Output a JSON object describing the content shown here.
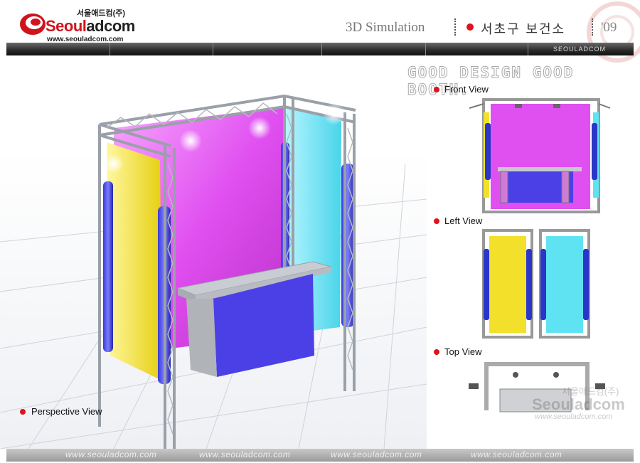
{
  "header": {
    "brand_prefix": "Seoul",
    "brand_suffix": "adcom",
    "brand_korean": "서울애드컴(주)",
    "brand_url": "www.seouladcom.com",
    "title": "3D Simulation",
    "client": "서초구 보건소",
    "year": "'09"
  },
  "navbar": {
    "label": "SEOULADCOM"
  },
  "slogan": "GOOD DESIGN GOOD BOOTH.",
  "views": {
    "front": "Front View",
    "left": "Left View",
    "top": "Top View",
    "perspective": "Perspective View"
  },
  "watermark": {
    "korean": "서울애드컴(주)",
    "brand": "Seouladcom",
    "url": "www.seouladcom.com"
  },
  "footer": {
    "urls": [
      "www.seouladcom.com",
      "www.seouladcom.com",
      "www.seouladcom.com",
      "www.seouladcom.com"
    ]
  },
  "colors": {
    "accent_red": "#e0121b",
    "panel_magenta": "#e04ff0",
    "panel_yellow": "#f2e02a",
    "panel_cyan": "#5fe3f2",
    "counter_blue": "#4a40e6",
    "pillar_blue": "#2a36c8"
  }
}
